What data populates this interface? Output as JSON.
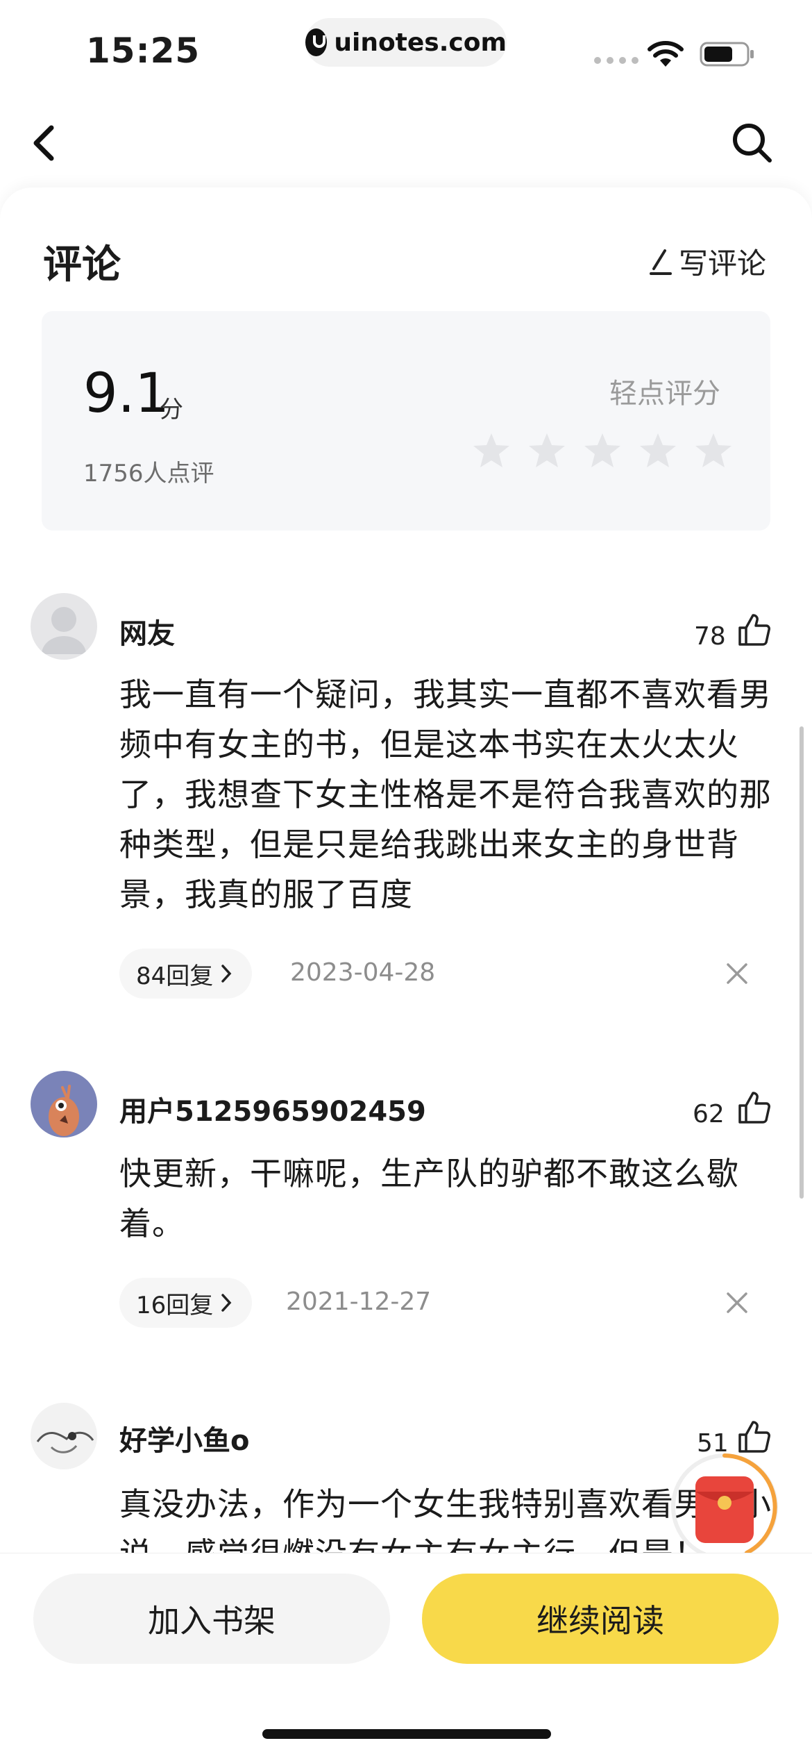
{
  "status_bar": {
    "time": "15:25",
    "url": "uinotes.com"
  },
  "header": {
    "title": "评论",
    "write_review_label": "写评论"
  },
  "rating": {
    "score": "9.1",
    "unit": "分",
    "count_label": "1756人点评",
    "prompt": "轻点评分",
    "stars_filled": 0,
    "stars_total": 5
  },
  "comments": [
    {
      "username": "网友",
      "likes": "78",
      "text": "我一直有一个疑问，我其实一直都不喜欢看男频中有女主的书，但是这本书实在太火太火了，我想查下女主性格是不是符合我喜欢的那种类型，但是只是给我跳出来女主的身世背景，我真的服了百度",
      "replies_label": "84回复",
      "date": "2023-04-28"
    },
    {
      "username": "用户5125965902459",
      "likes": "62",
      "text": "快更新，干嘛呢，生产队的驴都不敢这么歇着。",
      "replies_label": "16回复",
      "date": "2021-12-27"
    },
    {
      "username": "好学小鱼o",
      "likes": "51",
      "text": "真没办法，作为一个女生我特别喜欢看男频小说，感觉很燃没有女主有女主行，但是！"
    }
  ],
  "bottom_bar": {
    "add_shelf_label": "加入书架",
    "continue_label": "继续阅读"
  },
  "colors": {
    "accent": "#f8d94a",
    "star_empty": "#e4e5e8",
    "red_packet": "#e8453c"
  }
}
